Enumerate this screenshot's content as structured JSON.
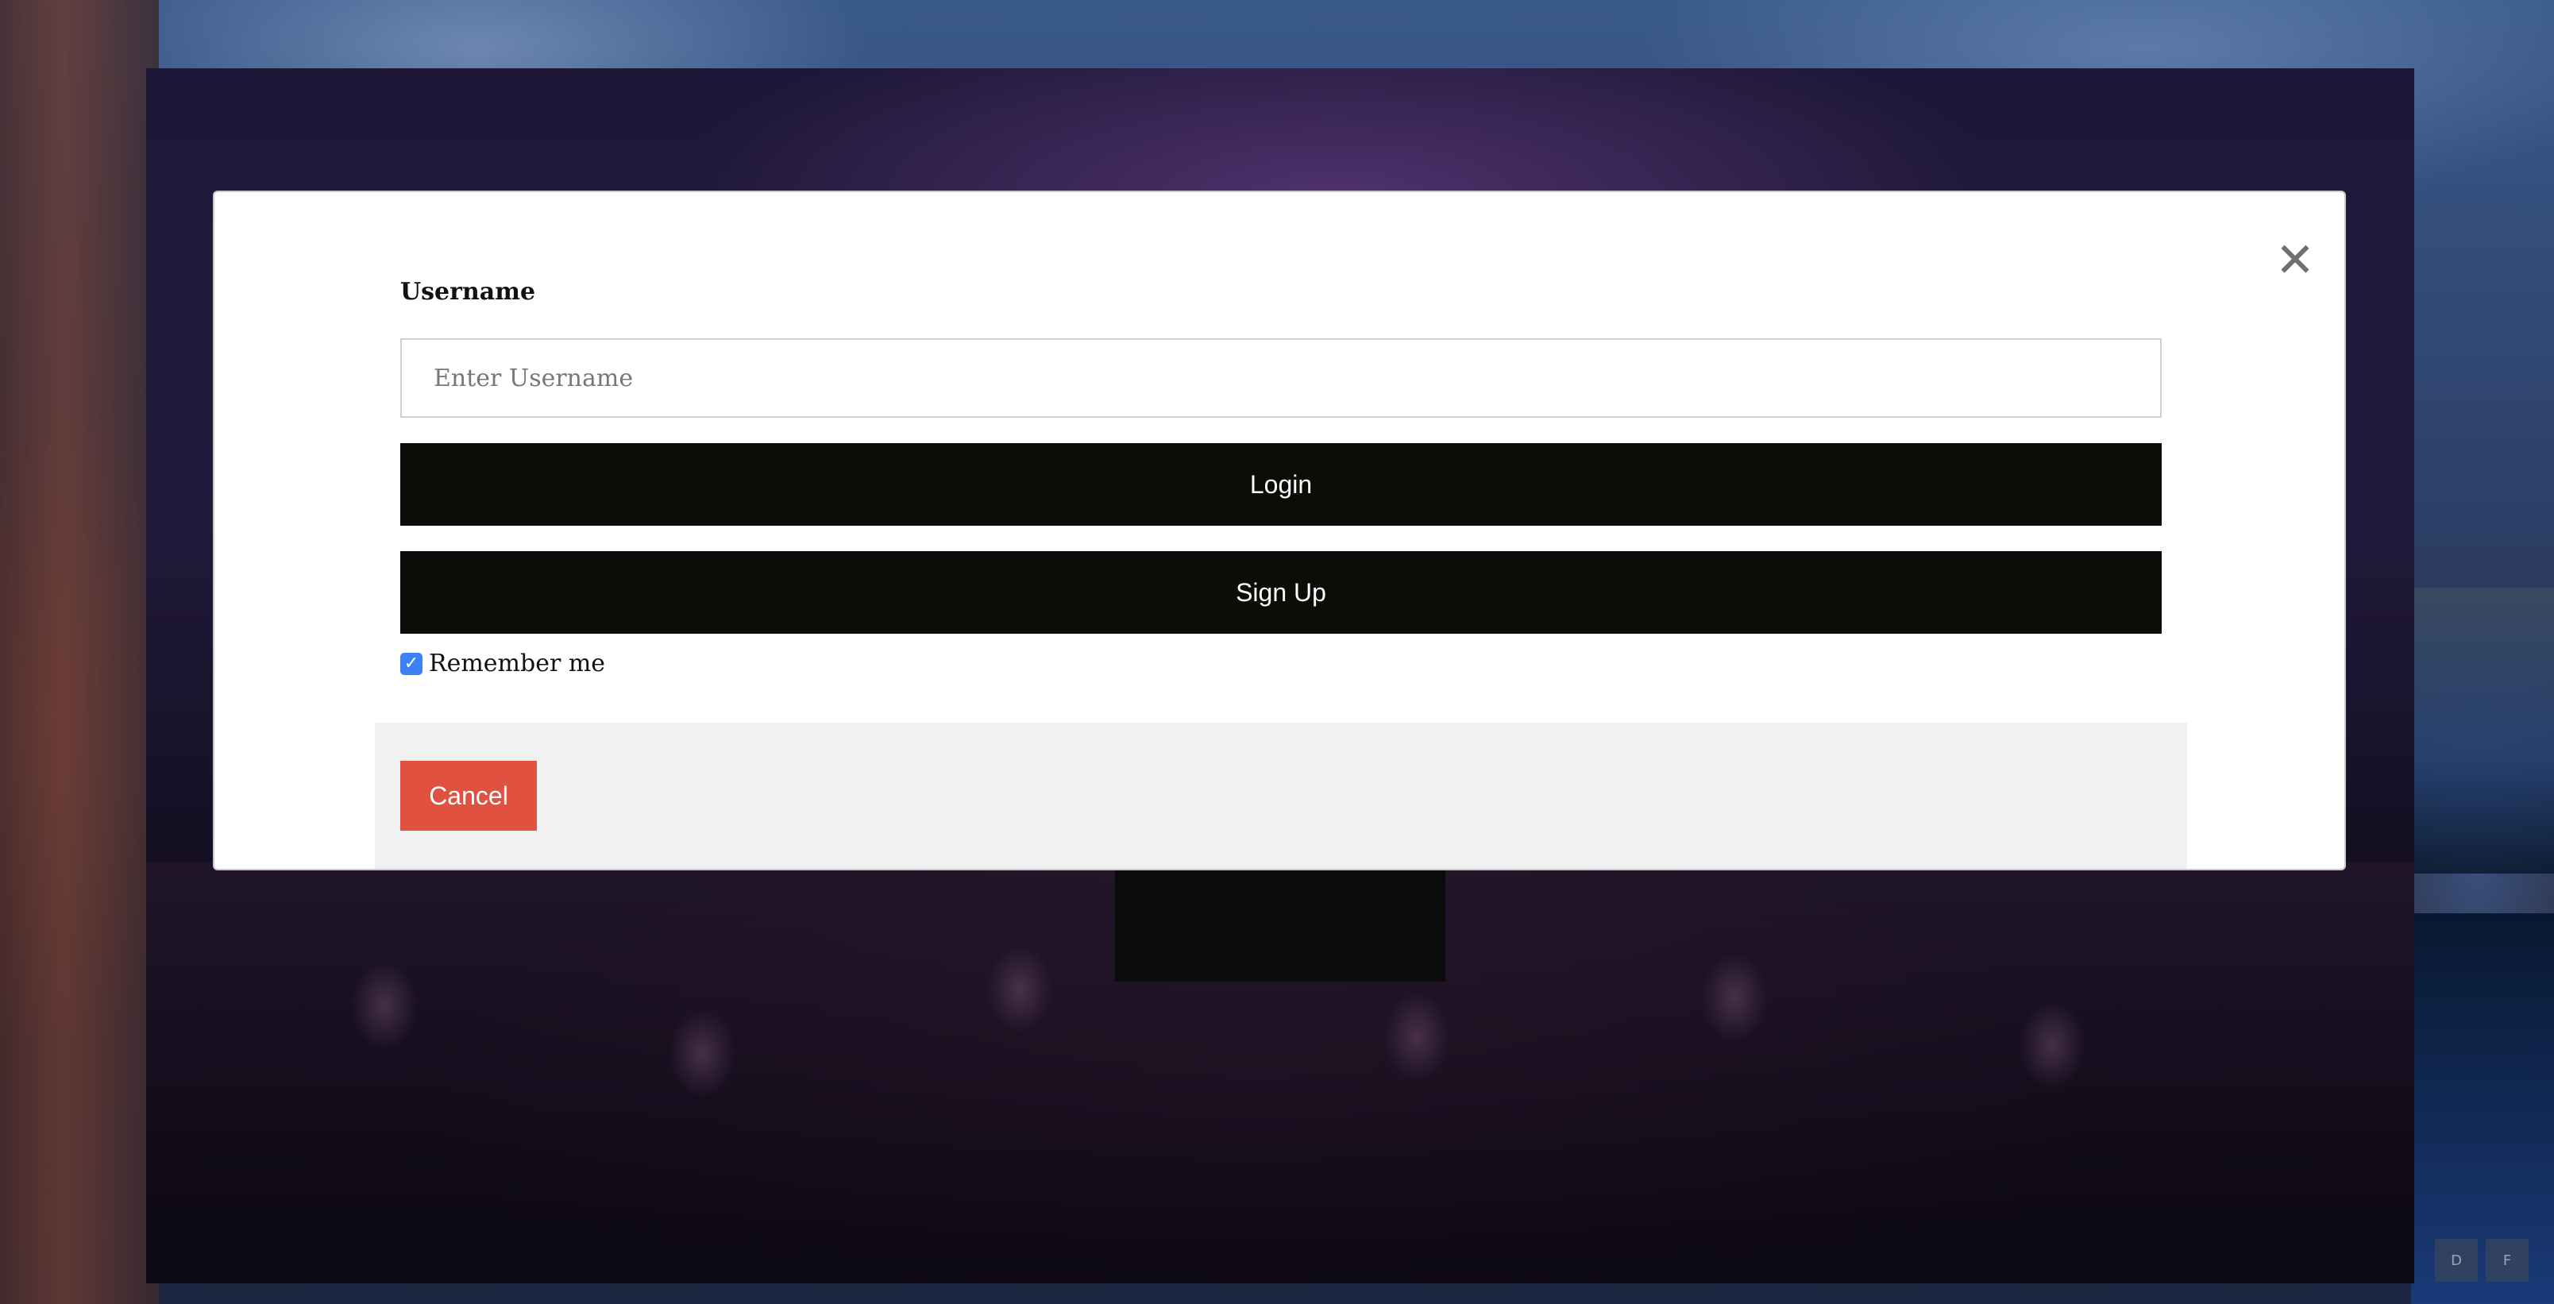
{
  "modal": {
    "close_glyph": "✕",
    "username_label": "Username",
    "username_placeholder": "Enter Username",
    "login_label": "Login",
    "signup_label": "Sign Up",
    "remember_label": "Remember me",
    "remember_checked": true,
    "checkbox_glyph": "✓",
    "cancel_label": "Cancel"
  },
  "background": {
    "corner_buttons": [
      "D",
      "F"
    ]
  },
  "colors": {
    "primary_button": "#0a0d08",
    "cancel_button": "#e05140",
    "checkbox": "#3b82f6",
    "footer_bg": "#f1f1f1"
  }
}
